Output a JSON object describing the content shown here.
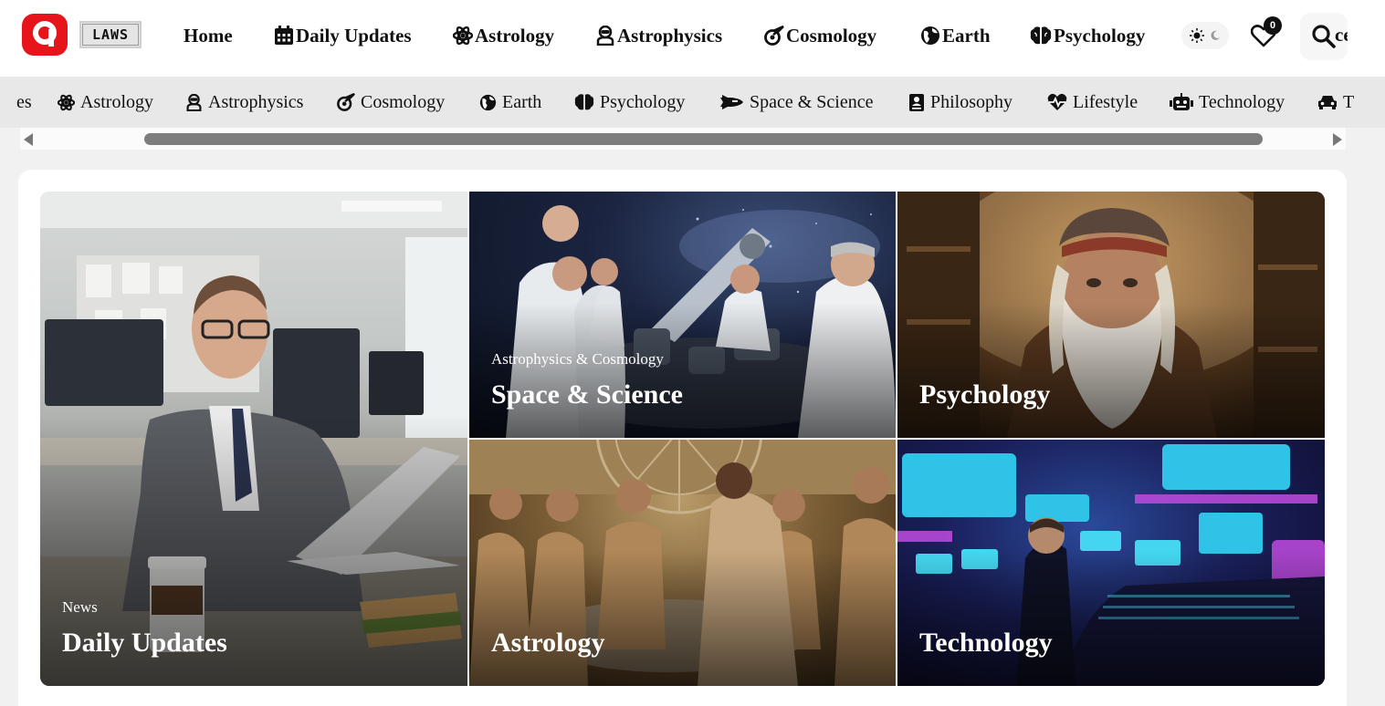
{
  "brand": {
    "badge_text": "LAWS",
    "logo_color": "#e8141b"
  },
  "nav": {
    "home": "Home",
    "items": [
      {
        "label": "Daily Updates",
        "icon": "calendar-icon"
      },
      {
        "label": "Astrology",
        "icon": "atom-icon"
      },
      {
        "label": "Astrophysics",
        "icon": "astronaut-icon"
      },
      {
        "label": "Cosmology",
        "icon": "meteor-icon"
      },
      {
        "label": "Earth",
        "icon": "globe-icon"
      },
      {
        "label": "Psychology",
        "icon": "brain-icon"
      }
    ],
    "wishlist_count": "0",
    "search_overflow_text": "ce"
  },
  "categories": {
    "cut_start": "es",
    "items": [
      {
        "label": "Astrology",
        "icon": "atom-icon"
      },
      {
        "label": "Astrophysics",
        "icon": "astronaut-icon"
      },
      {
        "label": "Cosmology",
        "icon": "meteor-icon"
      },
      {
        "label": "Earth",
        "icon": "globe-icon"
      },
      {
        "label": "Psychology",
        "icon": "brain-icon"
      },
      {
        "label": "Space & Science",
        "icon": "space-shuttle-icon"
      },
      {
        "label": "Philosophy",
        "icon": "book-icon"
      },
      {
        "label": "Lifestyle",
        "icon": "heartbeat-icon"
      },
      {
        "label": "Technology",
        "icon": "robot-icon"
      }
    ],
    "cut_end": "T"
  },
  "featured": [
    {
      "kicker": "News",
      "title": "Daily Updates"
    },
    {
      "kicker": "Astrophysics & Cosmology",
      "title": "Space & Science"
    },
    {
      "kicker": "",
      "title": "Psychology"
    },
    {
      "kicker": "",
      "title": "Astrology"
    },
    {
      "kicker": "",
      "title": "Technology"
    }
  ]
}
